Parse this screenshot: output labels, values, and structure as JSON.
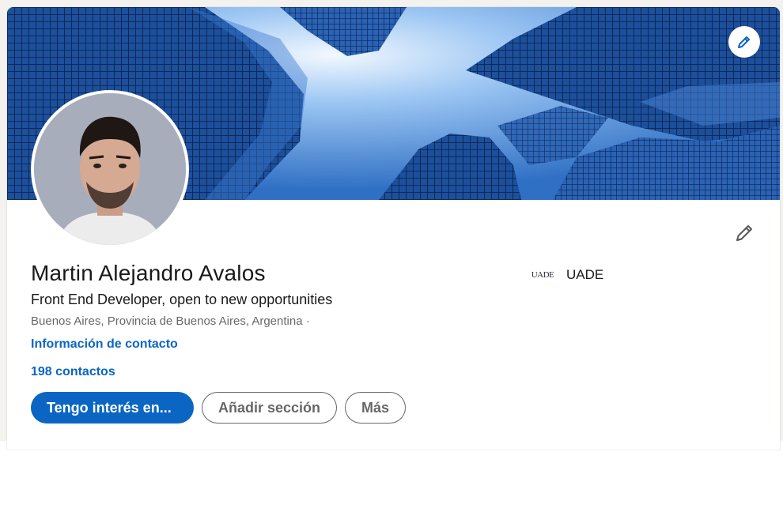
{
  "profile": {
    "name": "Martin Alejandro Avalos",
    "headline": "Front End Developer, open to new opportunities",
    "location": "Buenos Aires, Provincia de Buenos Aires, Argentina ·",
    "contact_info_label": "Información de contacto",
    "connections_label": "198 contactos"
  },
  "education": {
    "logo_text": "UADE",
    "school_name": "UADE"
  },
  "actions": {
    "primary_label": "Tengo interés en...",
    "add_section_label": "Añadir sección",
    "more_label": "Más"
  },
  "colors": {
    "accent": "#0a66c2",
    "page_background": "#f3f2ef",
    "cover_sky": "#5b9be0"
  },
  "icons": {
    "cover_edit": "pencil-icon",
    "intro_edit": "pencil-icon"
  }
}
